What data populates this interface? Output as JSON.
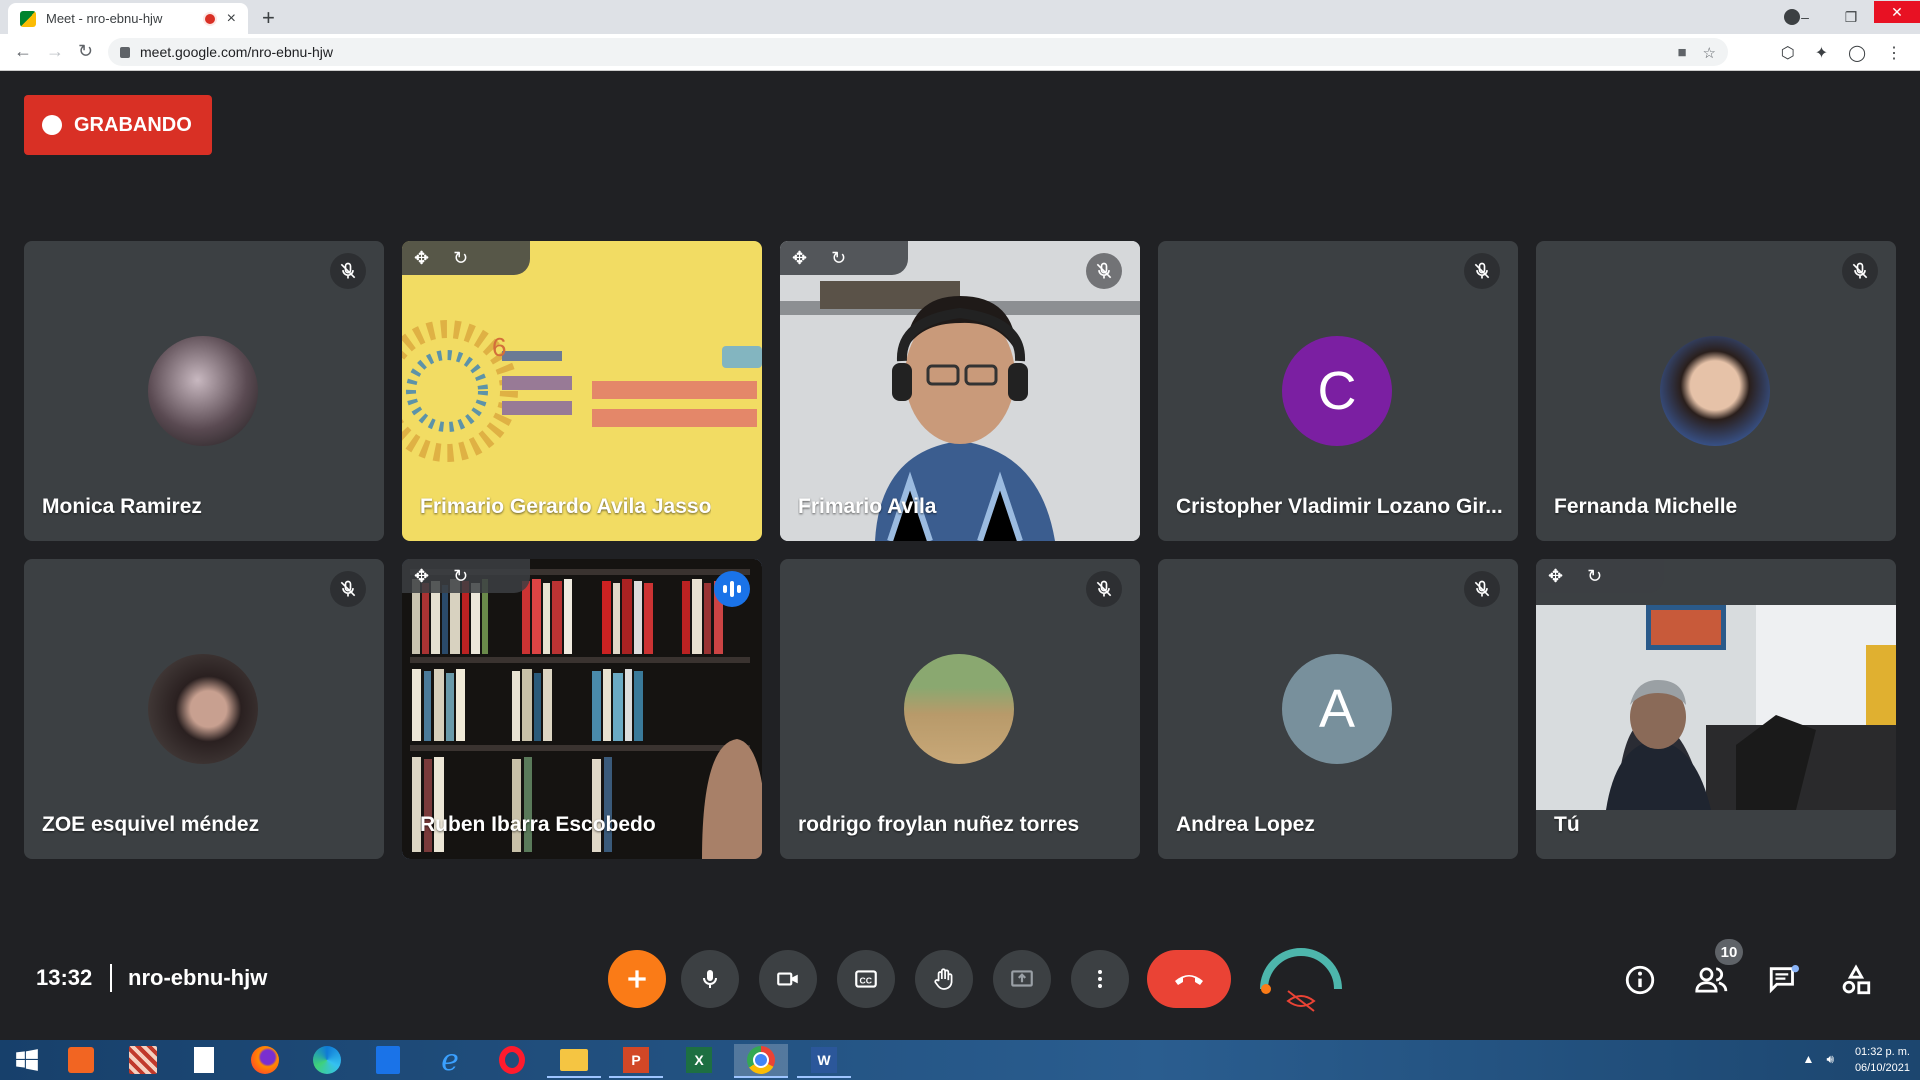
{
  "browser": {
    "tab_title": "Meet - nro-ebnu-hjw",
    "tab_close": "×",
    "new_tab": "+",
    "url": "meet.google.com/nro-ebnu-hjw",
    "back": "←",
    "forward": "→",
    "reload": "↻",
    "window": {
      "minimize": "–",
      "restore": "❐",
      "close": "✕"
    }
  },
  "recording_label": "GRABANDO",
  "participants": [
    {
      "name": "Monica Ramirez",
      "muted": true
    },
    {
      "name": "Frimario Gerardo Avila Jasso",
      "muted": false,
      "pinned_controls": true
    },
    {
      "name": "Frimario Avila",
      "muted": true,
      "pinned_controls": true
    },
    {
      "name": "Cristopher Vladimir Lozano Gir...",
      "muted": true,
      "initial": "C",
      "avatar_color": "#7b1fa2"
    },
    {
      "name": "Fernanda Michelle",
      "muted": true
    },
    {
      "name": "ZOE esquivel méndez",
      "muted": true
    },
    {
      "name": "Ruben Ibarra Escobedo",
      "muted": false,
      "speaking": true,
      "pinned_controls": true
    },
    {
      "name": "rodrigo froylan nuñez torres",
      "muted": true
    },
    {
      "name": "Andrea Lopez",
      "muted": true,
      "initial": "A",
      "avatar_color": "#78909c"
    },
    {
      "name": "Tú",
      "muted": false,
      "pinned_controls": true
    }
  ],
  "meeting": {
    "time": "13:32",
    "code": "nro-ebnu-hjw"
  },
  "controls": [
    "add",
    "microphone",
    "camera",
    "captions",
    "raise-hand",
    "present",
    "more-options",
    "leave-call",
    "effects"
  ],
  "right_controls": {
    "people_count": "10"
  },
  "taskbar": {
    "time": "01:32 p. m.",
    "date": "06/10/2021"
  },
  "colors": {
    "recording": "#d93025",
    "leave": "#ea4335",
    "add": "#fa7b17",
    "speaking_outline": "#8ab4f8"
  }
}
